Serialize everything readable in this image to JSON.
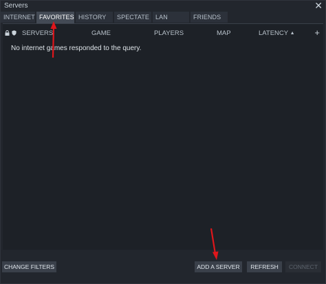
{
  "window": {
    "title": "Servers",
    "close_glyph": "✕"
  },
  "tabs": [
    {
      "label": "INTERNET",
      "active": false
    },
    {
      "label": "FAVORITES",
      "active": true
    },
    {
      "label": "HISTORY",
      "active": false
    },
    {
      "label": "SPECTATE",
      "active": false
    },
    {
      "label": "LAN",
      "active": false
    },
    {
      "label": "FRIENDS",
      "active": false
    }
  ],
  "columns": {
    "servers": "SERVERS",
    "game": "GAME",
    "players": "PLAYERS",
    "map": "MAP",
    "latency": "LATENCY",
    "latency_sort": "▲",
    "add_glyph": "+"
  },
  "list": {
    "empty_message": "No internet games responded to the query."
  },
  "footer": {
    "change_filters": "CHANGE FILTERS",
    "add_server": "ADD A SERVER",
    "refresh": "REFRESH",
    "connect": "CONNECT"
  },
  "colors": {
    "annotation_arrow": "#e0161b",
    "active_tab": "#434a55",
    "button": "#3a404a"
  }
}
